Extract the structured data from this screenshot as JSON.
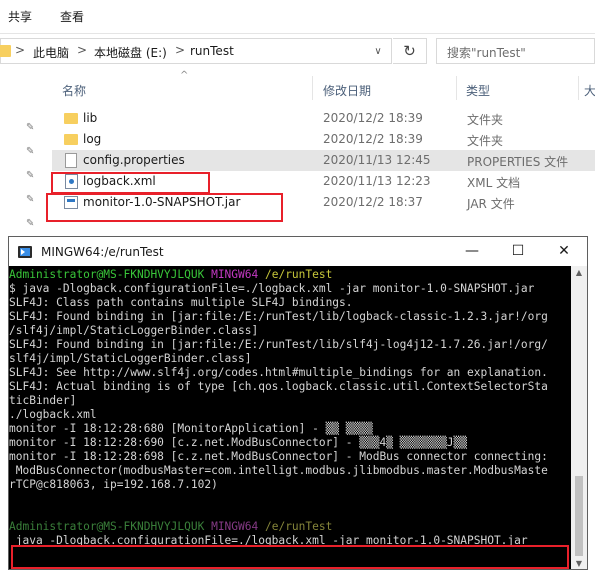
{
  "ribbon": {
    "tabs": [
      "共享",
      "查看"
    ]
  },
  "address": {
    "segments": [
      "此电脑",
      "本地磁盘 (E:)",
      "runTest"
    ],
    "separator": ">",
    "dropdown_glyph": "∨",
    "refresh_glyph": "↻"
  },
  "search": {
    "placeholder": "搜索\"runTest\""
  },
  "columns": {
    "name": "名称",
    "date": "修改日期",
    "type": "类型",
    "size": "大"
  },
  "files": [
    {
      "name": "lib",
      "date": "2020/12/2 18:39",
      "type": "文件夹",
      "icon": "folder-icon"
    },
    {
      "name": "log",
      "date": "2020/12/2 18:39",
      "type": "文件夹",
      "icon": "folder-icon"
    },
    {
      "name": "config.properties",
      "date": "2020/11/13 12:45",
      "type": "PROPERTIES 文件",
      "icon": "properties-file-icon"
    },
    {
      "name": "logback.xml",
      "date": "2020/11/13 12:23",
      "type": "XML 文档",
      "icon": "xml-file-icon"
    },
    {
      "name": "monitor-1.0-SNAPSHOT.jar",
      "date": "2020/12/2 18:37",
      "type": "JAR 文件",
      "icon": "jar-file-icon"
    }
  ],
  "terminal": {
    "title": "MINGW64:/e/runTest",
    "controls": {
      "minimize": "—",
      "maximize": "☐",
      "close": "✕"
    },
    "prompt": {
      "user": "Administrator@MS-FKNDHVYJLQUK",
      "host": "MINGW64",
      "path": "/e/runTest"
    },
    "lines": [
      "$ java -Dlogback.configurationFile=./logback.xml -jar monitor-1.0-SNAPSHOT.jar",
      "SLF4J: Class path contains multiple SLF4J bindings.",
      "SLF4J: Found binding in [jar:file:/E:/runTest/lib/logback-classic-1.2.3.jar!/org",
      "/slf4j/impl/StaticLoggerBinder.class]",
      "SLF4J: Found binding in [jar:file:/E:/runTest/lib/slf4j-log4j12-1.7.26.jar!/org/",
      "slf4j/impl/StaticLoggerBinder.class]",
      "SLF4J: See http://www.slf4j.org/codes.html#multiple_bindings for an explanation.",
      "SLF4J: Actual binding is of type [ch.qos.logback.classic.util.ContextSelectorSta",
      "ticBinder]",
      "./logback.xml",
      "monitor -I 18:12:28:680 [MonitorApplication] - ▒▒ ▒▒▒▒",
      "monitor -I 18:12:28:690 [c.z.net.ModBusConnector] - ▒▒▒4▒ ▒▒▒▒▒▒▒J▒▒",
      "monitor -I 18:12:28:698 [c.z.net.ModBusConnector] - ModBus connector connecting:",
      " ModBusConnector(modbusMaster=com.intelligt.modbus.jlibmodbus.master.ModbusMaste",
      "rTCP@c818063, ip=192.168.7.102)",
      "",
      ""
    ],
    "last_command": " java -Dlogback.configurationFile=./logback.xml -jar monitor-1.0-SNAPSHOT.jar"
  }
}
